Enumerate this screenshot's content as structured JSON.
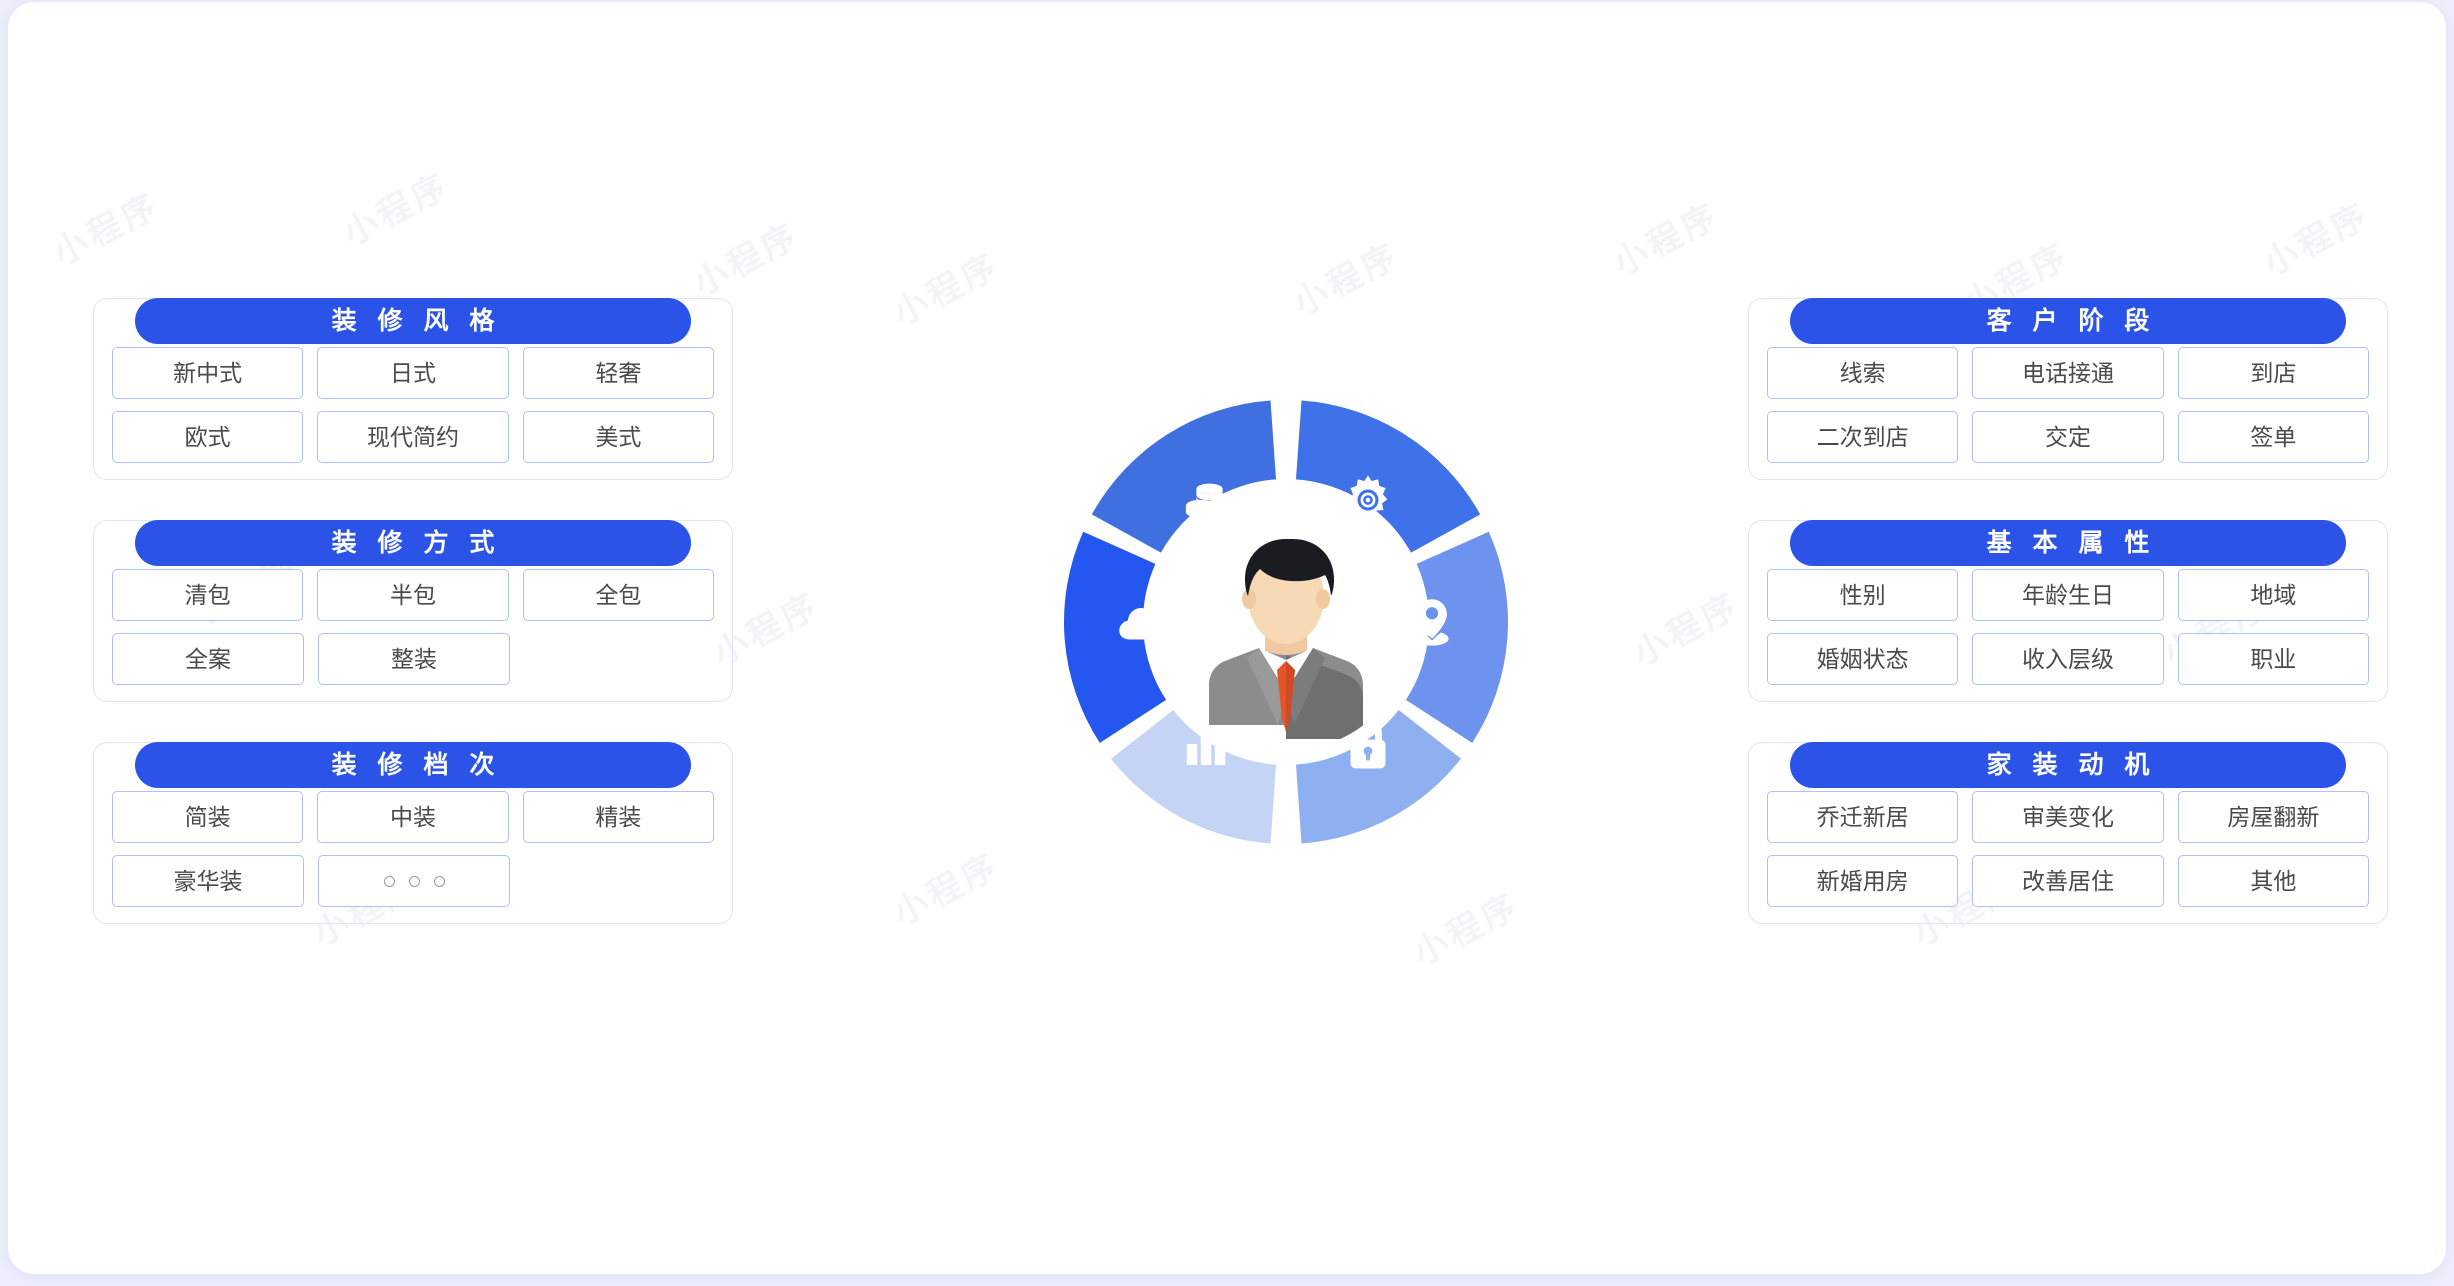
{
  "theme": {
    "page_background": "#eceefb",
    "card_background": "#ffffff",
    "header_pill": "#2b53e8",
    "tag_border": "#aebffa",
    "panel_border": "#dfe3f7",
    "tag_text": "#4a4a4a"
  },
  "watermark_text": "小程序",
  "left_column": {
    "panels": [
      {
        "title": "装 修 风 格",
        "rows": [
          [
            "新中式",
            "日式",
            "轻奢"
          ],
          [
            "欧式",
            "现代简约",
            "美式"
          ]
        ]
      },
      {
        "title": "装 修 方 式",
        "rows": [
          [
            "清包",
            "半包",
            "全包"
          ],
          [
            "全案",
            "整装",
            ""
          ]
        ]
      },
      {
        "title": "装 修 档 次",
        "rows": [
          [
            "简装",
            "中装",
            "精装"
          ],
          [
            "豪华装",
            "○ ○ ○",
            ""
          ]
        ]
      }
    ]
  },
  "right_column": {
    "panels": [
      {
        "title": "客 户 阶 段",
        "rows": [
          [
            "线索",
            "电话接通",
            "到店"
          ],
          [
            "二次到店",
            "交定",
            "签单"
          ]
        ]
      },
      {
        "title": "基 本 属 性",
        "rows": [
          [
            "性别",
            "年龄生日",
            "地域"
          ],
          [
            "婚姻状态",
            "收入层级",
            "职业"
          ]
        ]
      },
      {
        "title": "家 装 动 机",
        "rows": [
          [
            "乔迁新居",
            "审美变化",
            "房屋翻新"
          ],
          [
            "新婚用房",
            "改善居住",
            "其他"
          ]
        ]
      }
    ]
  },
  "center_graphic": {
    "center_icon": "businessman-avatar",
    "segments": [
      {
        "icon": "coins-icon",
        "color": "#4070e0",
        "position": "top-left"
      },
      {
        "icon": "gear-icon",
        "color": "#3f72e8",
        "position": "top-right"
      },
      {
        "icon": "location-pin-icon",
        "color": "#6e93ee",
        "position": "right"
      },
      {
        "icon": "lock-icon",
        "color": "#8eb0f0",
        "position": "bottom-right"
      },
      {
        "icon": "bar-chart-icon",
        "color": "#c5d4f5",
        "position": "bottom-left"
      },
      {
        "icon": "cloud-wifi-icon",
        "color": "#2456f0",
        "position": "left"
      }
    ]
  }
}
